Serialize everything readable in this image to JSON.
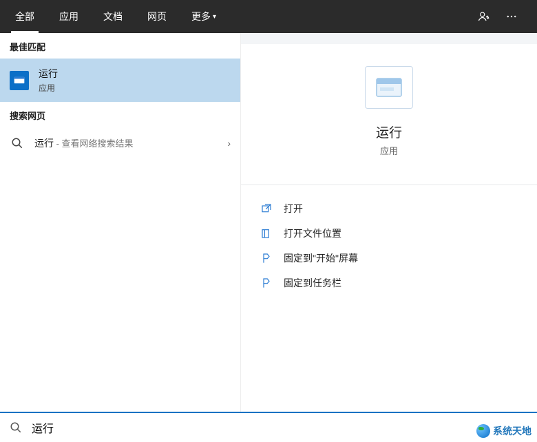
{
  "header": {
    "tabs": [
      "全部",
      "应用",
      "文档",
      "网页"
    ],
    "more": "更多"
  },
  "left": {
    "best_match_header": "最佳匹配",
    "result": {
      "title": "运行",
      "subtitle": "应用"
    },
    "web_header": "搜索网页",
    "web_query": "运行",
    "web_hint": " - 查看网络搜索结果"
  },
  "preview": {
    "title": "运行",
    "subtitle": "应用"
  },
  "actions": {
    "open": "打开",
    "open_location": "打开文件位置",
    "pin_start": "固定到\"开始\"屏幕",
    "pin_taskbar": "固定到任务栏"
  },
  "search": {
    "value": "运行"
  },
  "watermark": "系统天地"
}
